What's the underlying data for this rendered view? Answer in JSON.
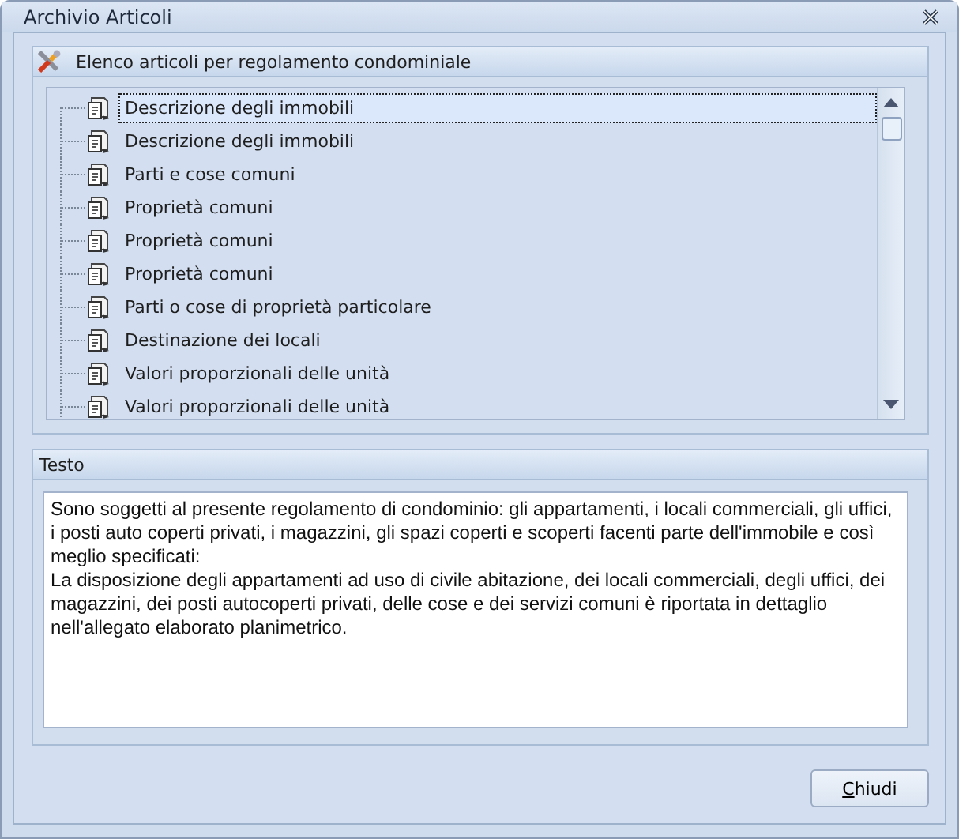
{
  "window": {
    "title": "Archivio Articoli"
  },
  "articles": {
    "title": "Elenco articoli per regolamento condominiale",
    "items": [
      {
        "label": "Descrizione degli immobili",
        "selected": true
      },
      {
        "label": "Descrizione degli immobili",
        "selected": false
      },
      {
        "label": "Parti e cose comuni",
        "selected": false
      },
      {
        "label": "Proprietà comuni",
        "selected": false
      },
      {
        "label": "Proprietà comuni",
        "selected": false
      },
      {
        "label": "Proprietà comuni",
        "selected": false
      },
      {
        "label": "Parti o cose di proprietà particolare",
        "selected": false
      },
      {
        "label": "Destinazione dei locali",
        "selected": false
      },
      {
        "label": "Valori proporzionali delle unità",
        "selected": false
      },
      {
        "label": "Valori proporzionali delle unità",
        "selected": false
      }
    ]
  },
  "text_panel": {
    "title": "Testo",
    "paragraphs": [
      "Sono soggetti al presente regolamento di condominio: gli appartamenti, i locali commerciali, gli uffici, i posti auto coperti privati, i magazzini, gli spazi coperti e scoperti facenti parte dell'immobile e così meglio specificati:",
      "La disposizione degli appartamenti ad uso di civile abitazione, dei locali commerciali, degli uffici, dei magazzini, dei posti autocoperti privati, delle cose e dei servizi comuni è riportata in dettaglio nell'allegato elaborato planimetrico."
    ]
  },
  "buttons": [
    {
      "label": "Chiudi"
    }
  ]
}
